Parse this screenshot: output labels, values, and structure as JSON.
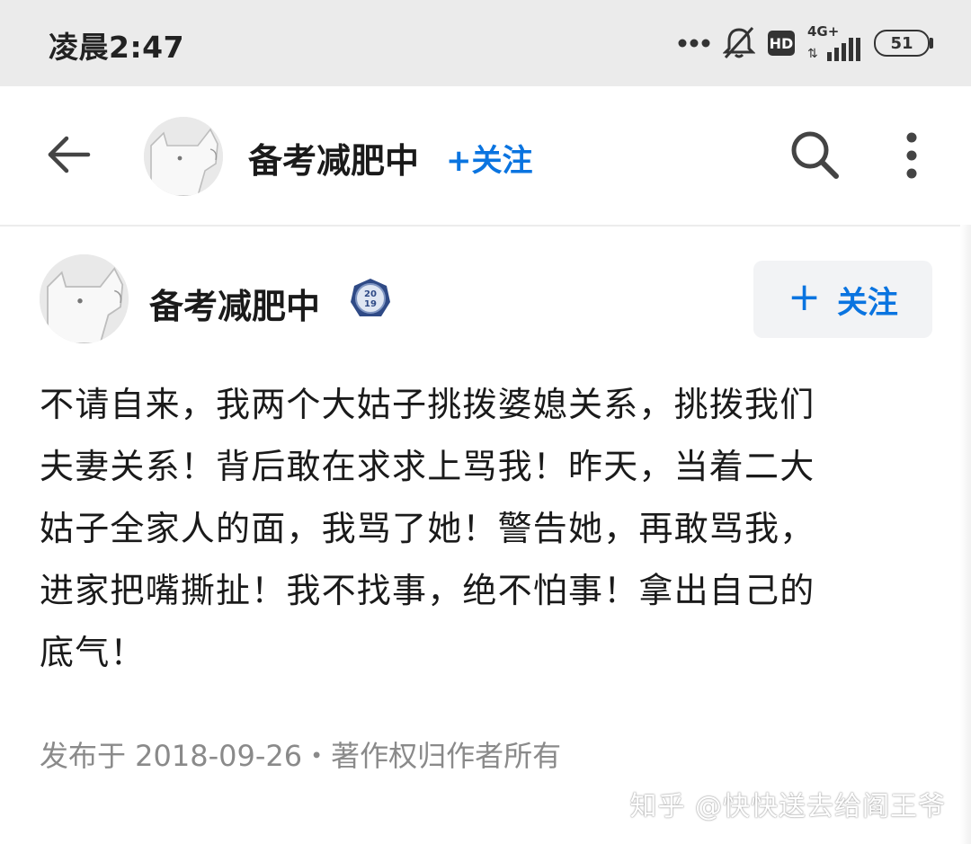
{
  "status_bar": {
    "time": "凌晨2:47",
    "network": "4G+",
    "hd_label": "HD",
    "battery": "51"
  },
  "nav": {
    "title": "备考减肥中",
    "follow_label": "+关注"
  },
  "author": {
    "name": "备考减肥中",
    "badge_text": "2019",
    "follow_plus": "+",
    "follow_label": "关注"
  },
  "post": {
    "lines": [
      "不请自来，我两个大姑子挑拨婆媳关系，挑拨我们",
      "夫妻关系！背后敢在求求上骂我！昨天，当着二大",
      "姑子全家人的面，我骂了她！警告她，再敢骂我，",
      "进家把嘴撕扯！我不找事，绝不怕事！拿出自己的",
      "底气！"
    ],
    "meta": "发布于 2018-09-26・著作权归作者所有"
  },
  "watermark": "知乎 @快快送去给阎王爷",
  "colors": {
    "accent": "#0a74e0",
    "status_bg": "#ebebeb",
    "meta_text": "#8a8a8a"
  },
  "icons": [
    "back-arrow-icon",
    "search-icon",
    "more-vertical-icon",
    "mute-bell-icon",
    "signal-icon",
    "battery-icon",
    "badge-2019-icon"
  ]
}
